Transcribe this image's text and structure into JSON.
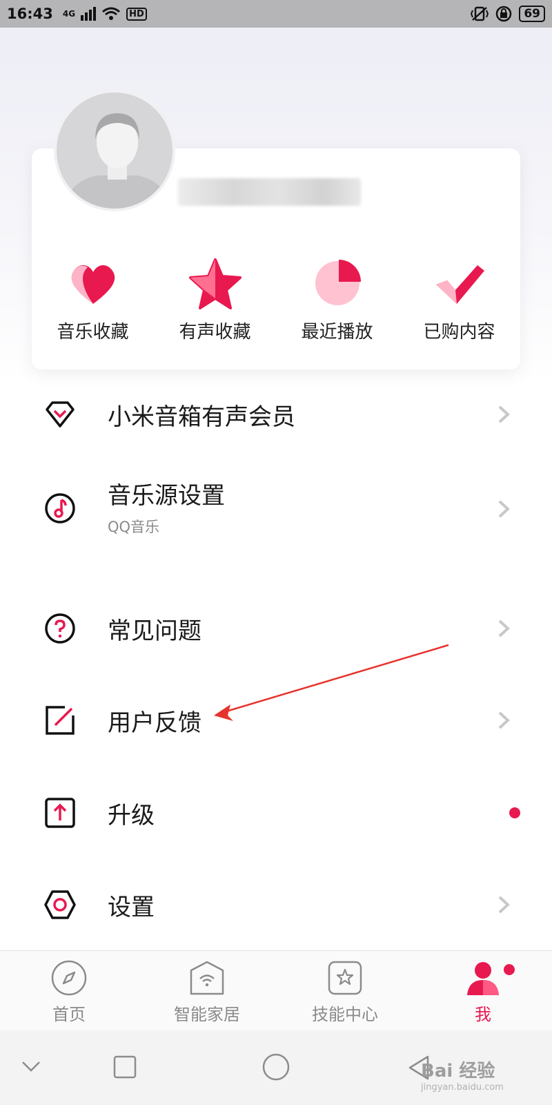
{
  "status_bar": {
    "time": "16:43",
    "network": "4G",
    "hd": "HD",
    "battery": "69"
  },
  "profile": {
    "avatar": "default-avatar",
    "name_blurred": ""
  },
  "quick_actions": [
    {
      "label": "音乐收藏",
      "icon": "heart-icon"
    },
    {
      "label": "有声收藏",
      "icon": "star-icon"
    },
    {
      "label": "最近播放",
      "icon": "pie-clock-icon"
    },
    {
      "label": "已购内容",
      "icon": "checkmark-icon"
    }
  ],
  "menu": {
    "vip": {
      "label": "小米音箱有声会员",
      "icon": "diamond-icon"
    },
    "music_source": {
      "label": "音乐源设置",
      "subtitle": "QQ音乐",
      "icon": "music-note-icon"
    },
    "faq": {
      "label": "常见问题",
      "icon": "question-icon"
    },
    "feedback": {
      "label": "用户反馈",
      "icon": "edit-square-icon"
    },
    "upgrade": {
      "label": "升级",
      "icon": "upload-arrow-icon"
    },
    "settings": {
      "label": "设置",
      "icon": "hexagon-settings-icon"
    }
  },
  "tabs": [
    {
      "label": "首页",
      "icon": "compass-icon"
    },
    {
      "label": "智能家居",
      "icon": "home-wifi-icon"
    },
    {
      "label": "技能中心",
      "icon": "star-square-icon"
    },
    {
      "label": "我",
      "icon": "person-icon",
      "active": true
    }
  ],
  "watermark": {
    "text": "Bai 经验",
    "sub": "jingyan.baidu.com"
  },
  "colors": {
    "accent": "#e8194f",
    "accent_light": "#ffb3c6"
  }
}
